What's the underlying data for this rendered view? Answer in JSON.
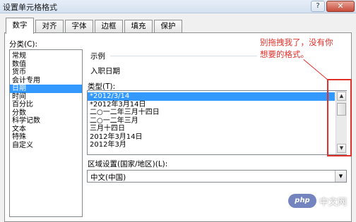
{
  "window": {
    "title": "设置单元格格式",
    "help_glyph": "?",
    "close_glyph": "✕"
  },
  "tabs": [
    {
      "label": "数字",
      "active": true
    },
    {
      "label": "对齐"
    },
    {
      "label": "字体"
    },
    {
      "label": "边框"
    },
    {
      "label": "填充"
    },
    {
      "label": "保护"
    }
  ],
  "category": {
    "label": "分类(C):",
    "items": [
      "常规",
      "数值",
      "货币",
      "会计专用",
      "日期",
      "时间",
      "百分比",
      "分数",
      "科学记数",
      "文本",
      "特殊",
      "自定义"
    ],
    "selected": "日期"
  },
  "sample": {
    "label": "示例",
    "value": "入职日期"
  },
  "type": {
    "label": "类型(T):",
    "items": [
      "*2012/3/14",
      "*2012年3月14日",
      "二○一二年三月十四日",
      "二○一二年三月",
      "三月十四日",
      "2012年3月14日",
      "2012年3月"
    ],
    "selected": "*2012/3/14"
  },
  "locale": {
    "label": "区域设置(国家/地区)(L):",
    "value": "中文(中国)"
  },
  "annotation": {
    "line1": "别拖拽我了，没有你",
    "line2": "想要的格式。",
    "color": "#e0302a"
  },
  "watermark": {
    "logo": "php",
    "text": "中文网"
  }
}
